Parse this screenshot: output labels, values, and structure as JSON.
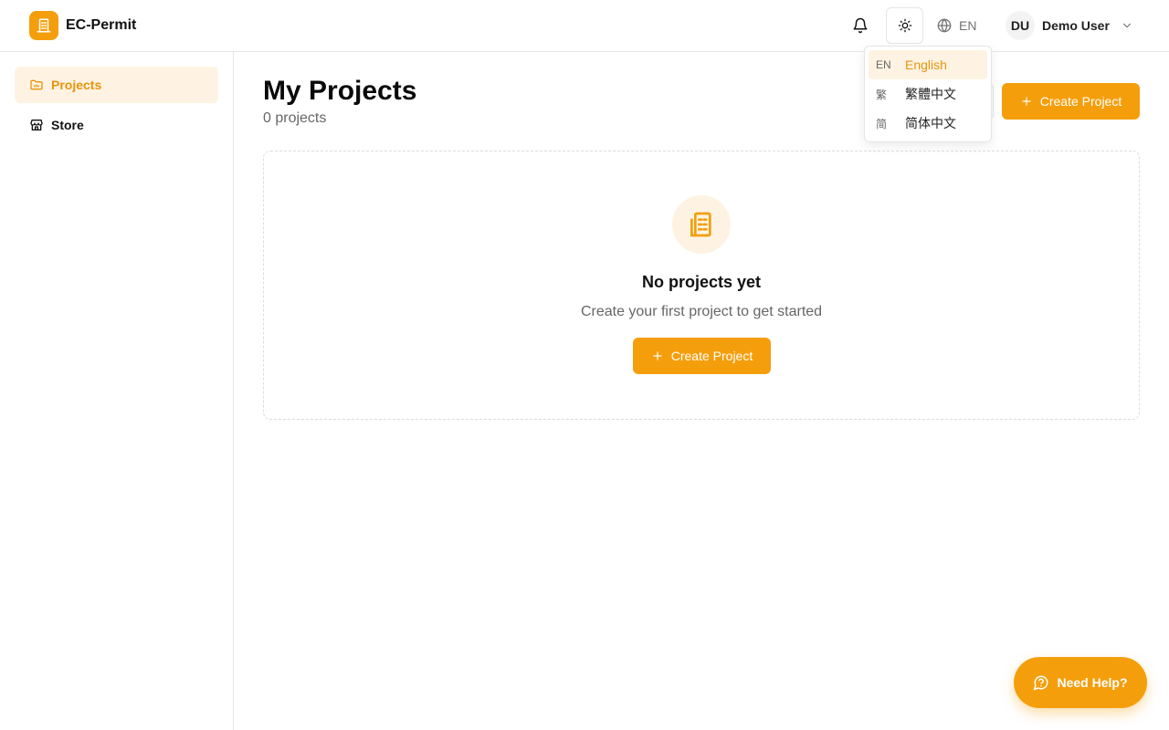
{
  "header": {
    "app_title": "EC-Permit",
    "language_code": "EN",
    "user_initials": "DU",
    "user_name": "Demo User"
  },
  "sidebar": {
    "items": [
      {
        "label": "Projects",
        "icon": "folder-icon",
        "active": true
      },
      {
        "label": "Store",
        "icon": "store-icon",
        "active": false
      }
    ]
  },
  "main": {
    "title": "My Projects",
    "subtitle": "0 projects",
    "create_button_label": "Create Project",
    "empty_state": {
      "icon": "building-icon",
      "title": "No projects yet",
      "subtitle": "Create your first project to get started",
      "button_label": "Create Project"
    }
  },
  "language_menu": {
    "options": [
      {
        "code": "EN",
        "label": "English",
        "selected": true
      },
      {
        "code": "繁",
        "label": "繁體中文",
        "selected": false
      },
      {
        "code": "简",
        "label": "简体中文",
        "selected": false
      }
    ]
  },
  "help_button": {
    "label": "Need Help?"
  },
  "colors": {
    "accent": "#f59e0b",
    "accent_light": "#fef3e2",
    "accent_text": "#e8940c"
  }
}
